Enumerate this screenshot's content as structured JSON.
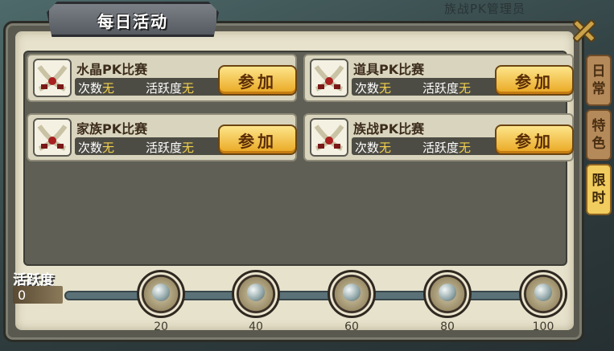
{
  "window": {
    "title": "每日活动",
    "background_npc_text": "族战PK管理员"
  },
  "tabs": [
    {
      "label_top": "日",
      "label_bottom": "常",
      "active": false
    },
    {
      "label_top": "特",
      "label_bottom": "色",
      "active": false
    },
    {
      "label_top": "限",
      "label_bottom": "时",
      "active": true
    }
  ],
  "events": [
    {
      "name": "水晶PK比赛",
      "count_label": "次数",
      "count_value": "无",
      "activity_label": "活跃度",
      "activity_value": "无",
      "button": "参加",
      "icon": "crossed-swords-icon"
    },
    {
      "name": "道具PK比赛",
      "count_label": "次数",
      "count_value": "无",
      "activity_label": "活跃度",
      "activity_value": "无",
      "button": "参加",
      "icon": "crossed-swords-icon"
    },
    {
      "name": "家族PK比赛",
      "count_label": "次数",
      "count_value": "无",
      "activity_label": "活跃度",
      "activity_value": "无",
      "button": "参加",
      "icon": "crossed-swords-icon"
    },
    {
      "name": "族战PK比赛",
      "count_label": "次数",
      "count_value": "无",
      "activity_label": "活跃度",
      "activity_value": "无",
      "button": "参加",
      "icon": "crossed-swords-icon"
    }
  ],
  "activity": {
    "label": "活跃度",
    "value": "0",
    "milestones": [
      "20",
      "40",
      "60",
      "80",
      "100"
    ]
  },
  "colors": {
    "accent_gold": "#f4d14e",
    "button_gold": "#e9a620",
    "active_tab": "#f1cc5e"
  }
}
